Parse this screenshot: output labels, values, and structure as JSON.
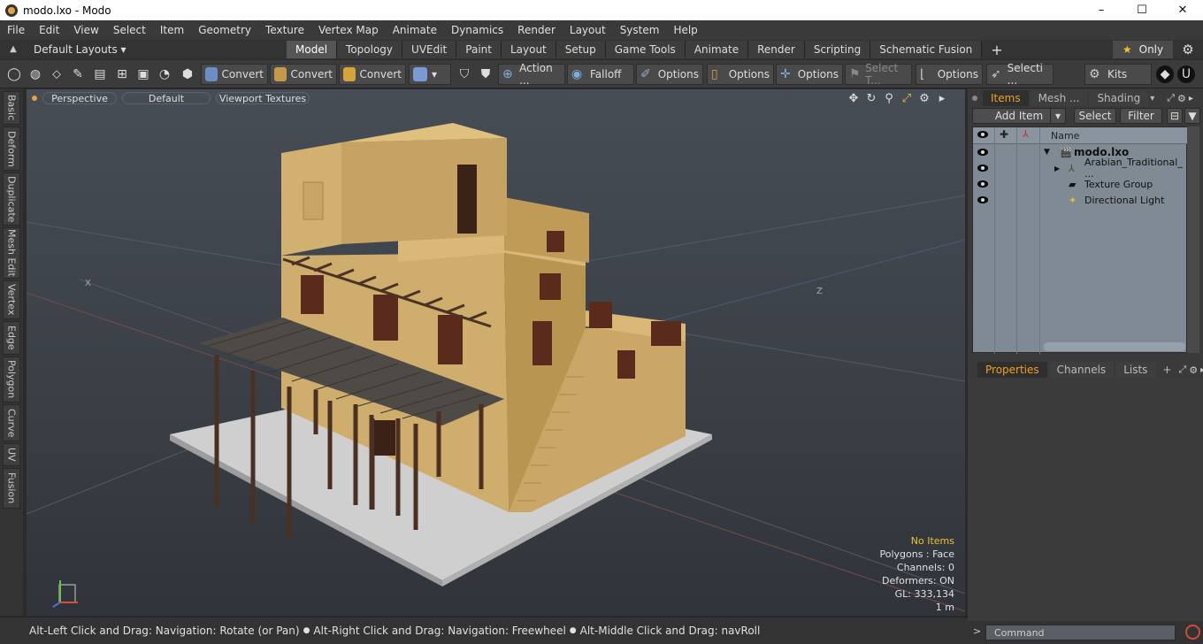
{
  "window": {
    "title": "modo.lxo - Modo",
    "minimize": "–",
    "maximize": "☐",
    "close": "✕"
  },
  "menu": [
    "File",
    "Edit",
    "View",
    "Select",
    "Item",
    "Geometry",
    "Texture",
    "Vertex Map",
    "Animate",
    "Dynamics",
    "Render",
    "Layout",
    "System",
    "Help"
  ],
  "layouts": {
    "label": "Default Layouts ▾"
  },
  "tabs": [
    "Model",
    "Topology",
    "UVEdit",
    "Paint",
    "Layout",
    "Setup",
    "Game Tools",
    "Animate",
    "Render",
    "Scripting",
    "Schematic Fusion"
  ],
  "only": {
    "label": "Only"
  },
  "toolbar": {
    "convert1": "Convert",
    "convert2": "Convert",
    "convert3": "Convert",
    "action": "Action   ...",
    "falloff": "Falloff",
    "options1": "Options",
    "options2": "Options",
    "options3": "Options",
    "selectt": "Select T...",
    "options4": "Options",
    "selecti": "Selecti ...",
    "kits": "Kits"
  },
  "lefttabs": [
    "Basic",
    "Deform",
    "Duplicate",
    "Mesh Edit",
    "Vertex",
    "Edge",
    "Polygon",
    "Curve",
    "UV",
    "Fusion"
  ],
  "viewport": {
    "view": "Perspective",
    "shading": "Default",
    "textures": "Viewport Textures",
    "axis_x": "X",
    "axis_z": "Z"
  },
  "info": {
    "noitems": "No Items",
    "polygons": "Polygons : Face",
    "channels": "Channels: 0",
    "deformers": "Deformers: ON",
    "gl": "GL: 333,134",
    "scale": "1 m"
  },
  "statusbar": {
    "text1": "Alt-Left Click and Drag: Navigation: Rotate (or Pan)",
    "text2": "Alt-Right Click and Drag: Navigation: Freewheel",
    "text3": "Alt-Middle Click and Drag: navRoll"
  },
  "panel": {
    "items_tab": "Items",
    "mesh_tab": "Mesh ...",
    "shading_tab": "Shading",
    "add_item": "Add Item",
    "select": "Select",
    "filter": "Filter",
    "name_col": "Name",
    "rows": [
      "modo.lxo",
      "Arabian_Traditional_ ...",
      "Texture Group",
      "Directional Light"
    ],
    "properties_tab": "Properties",
    "channels_tab": "Channels",
    "lists_tab": "Lists"
  },
  "command": {
    "placeholder": "Command"
  },
  "colors": {
    "accent": "#f0a020",
    "viewport_bg": "#434950",
    "panel_list": "#7f8a95",
    "wall": "#d3b06f"
  }
}
